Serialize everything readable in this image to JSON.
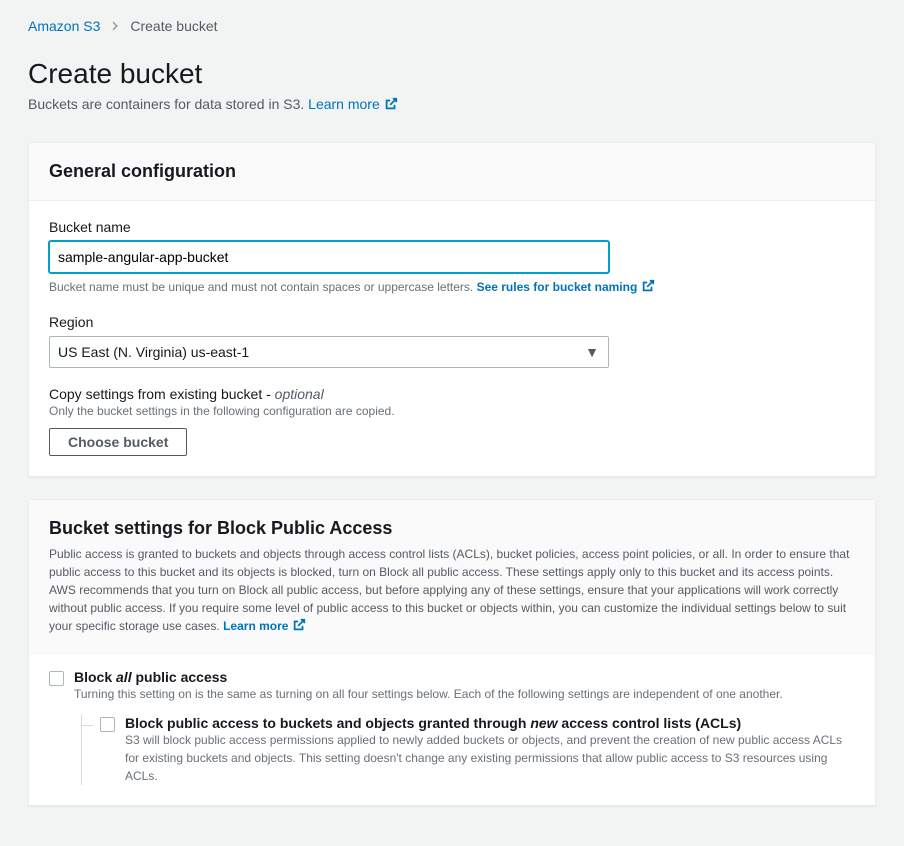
{
  "breadcrumb": {
    "root": "Amazon S3",
    "current": "Create bucket"
  },
  "page": {
    "title": "Create bucket",
    "subtitle_prefix": "Buckets are containers for data stored in S3. ",
    "learn_more": "Learn more"
  },
  "general": {
    "heading": "General configuration",
    "bucket_name_label": "Bucket name",
    "bucket_name_value": "sample-angular-app-bucket",
    "bucket_name_hint": "Bucket name must be unique and must not contain spaces or uppercase letters. ",
    "bucket_name_rules_link": "See rules for bucket naming",
    "region_label": "Region",
    "region_value": "US East (N. Virginia) us-east-1",
    "copy_label_prefix": "Copy settings from existing bucket - ",
    "copy_label_optional": "optional",
    "copy_hint": "Only the bucket settings in the following configuration are copied.",
    "choose_bucket_btn": "Choose bucket"
  },
  "block_public": {
    "heading": "Bucket settings for Block Public Access",
    "description": "Public access is granted to buckets and objects through access control lists (ACLs), bucket policies, access point policies, or all. In order to ensure that public access to this bucket and its objects is blocked, turn on Block all public access. These settings apply only to this bucket and its access points. AWS recommends that you turn on Block all public access, but before applying any of these settings, ensure that your applications will work correctly without public access. If you require some level of public access to this bucket or objects within, you can customize the individual settings below to suit your specific storage use cases. ",
    "learn_more": "Learn more",
    "block_all": {
      "label_prefix": "Block ",
      "label_emph": "all",
      "label_suffix": " public access",
      "desc": "Turning this setting on is the same as turning on all four settings below. Each of the following settings are independent of one another."
    },
    "child1": {
      "label_prefix": "Block public access to buckets and objects granted through ",
      "label_emph": "new",
      "label_suffix": " access control lists (ACLs)",
      "desc": "S3 will block public access permissions applied to newly added buckets or objects, and prevent the creation of new public access ACLs for existing buckets and objects. This setting doesn't change any existing permissions that allow public access to S3 resources using ACLs."
    }
  }
}
